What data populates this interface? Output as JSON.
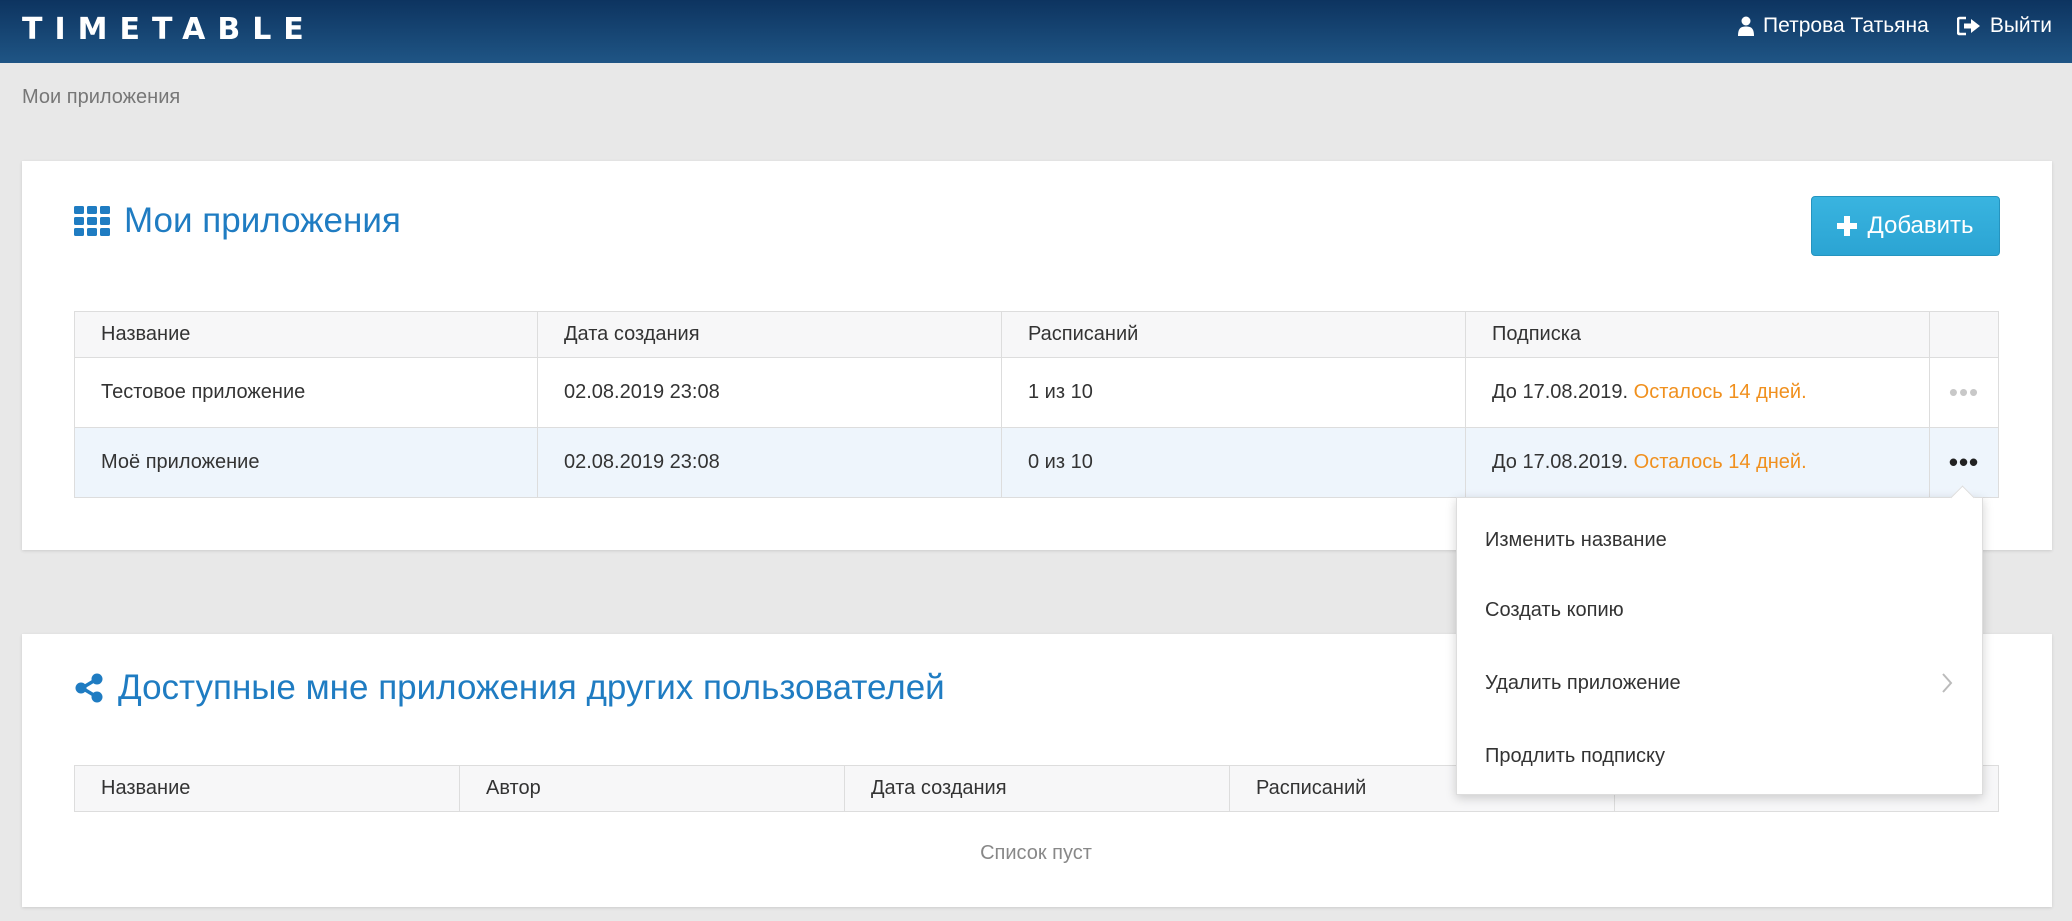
{
  "header": {
    "logo": "TIMETABLE",
    "user_name": "Петрова Татьяна",
    "logout_label": "Выйти"
  },
  "breadcrumb": "Мои приложения",
  "my_apps": {
    "title": "Мои приложения",
    "add_label": "Добавить",
    "columns": [
      "Название",
      "Дата создания",
      "Расписаний",
      "Подписка",
      ""
    ],
    "rows": [
      {
        "name": "Тестовое приложение",
        "created": "02.08.2019 23:08",
        "schedules": "1 из 10",
        "subscription": "До 17.08.2019.",
        "remaining": "Осталось 14 дней."
      },
      {
        "name": "Моё приложение",
        "created": "02.08.2019 23:08",
        "schedules": "0 из 10",
        "subscription": "До 17.08.2019.",
        "remaining": "Осталось 14 дней."
      }
    ],
    "row_actions": "•••"
  },
  "context_menu": {
    "items": [
      "Изменить название",
      "Создать копию",
      "Удалить приложение",
      "Продлить подписку"
    ]
  },
  "shared_apps": {
    "title": "Доступные мне приложения других пользователей",
    "columns": [
      "Название",
      "Автор",
      "Дата создания",
      "Расписаний",
      ""
    ],
    "empty_text": "Список пуст"
  },
  "colors": {
    "accent": "#1f7cc2",
    "button": "#2ba4d3",
    "warning": "#f0901e",
    "header": "#1a4a78"
  },
  "icons": {
    "user": "user-icon",
    "logout": "sign-out-icon",
    "grid": "grid-icon",
    "plus": "plus-icon",
    "share": "share-icon",
    "chevron": "chevron-right-icon"
  }
}
